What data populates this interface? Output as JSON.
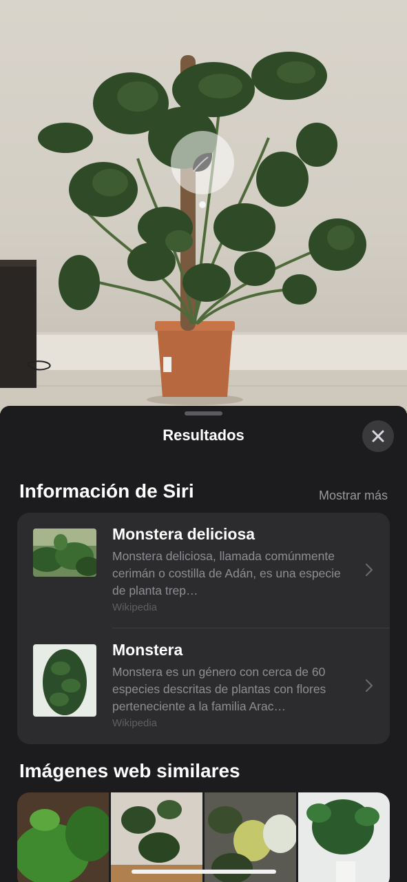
{
  "photo": {
    "lookup_icon": "leaf-icon",
    "subject_label": ""
  },
  "sheet": {
    "title": "Resultados",
    "close_icon": "close-icon"
  },
  "siri_section": {
    "title": "Información de Siri",
    "show_more": "Mostrar más",
    "results": [
      {
        "title": "Monstera deliciosa",
        "description": "Monstera deliciosa, llamada comúnmente cerimán o costilla de Adán, es una especie de planta trep…",
        "source": "Wikipedia"
      },
      {
        "title": "Monstera",
        "description": "Monstera es un género con cerca de 60 especies descritas  de plantas con flores perteneciente a la familia Arac…",
        "source": "Wikipedia"
      }
    ]
  },
  "web_images_section": {
    "title": "Imágenes web similares"
  },
  "colors": {
    "sheet_bg": "#1c1c1e",
    "card_bg": "#2c2c2e",
    "text_primary": "#ffffff",
    "text_secondary": "#8e8e93"
  }
}
